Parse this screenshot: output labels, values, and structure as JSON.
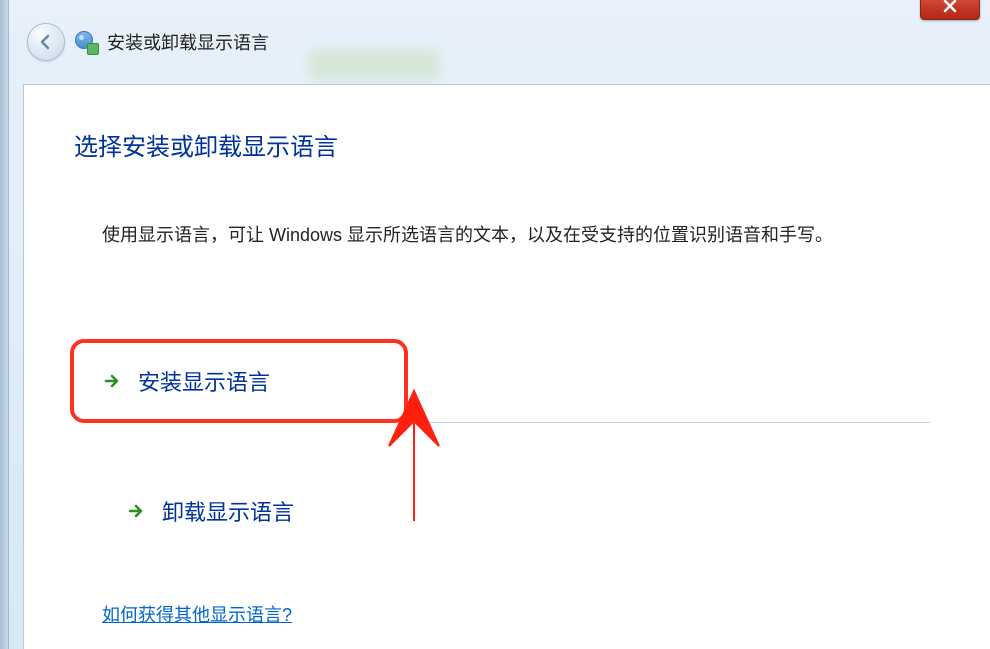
{
  "window": {
    "title": "安装或卸载显示语言"
  },
  "content": {
    "heading": "选择安装或卸载显示语言",
    "description": "使用显示语言，可让 Windows 显示所选语言的文本，以及在受支持的位置识别语音和手写。",
    "options": {
      "install": "安装显示语言",
      "uninstall": "卸载显示语言"
    },
    "help_link": "如何获得其他显示语言?"
  }
}
